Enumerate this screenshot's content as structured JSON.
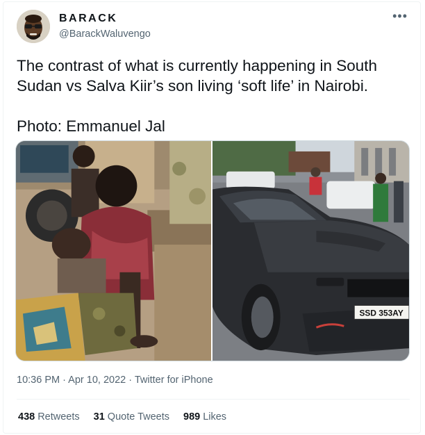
{
  "tweet": {
    "author": {
      "display_name": "BARACK",
      "handle": "@BarackWaluvengo"
    },
    "more_icon": "more-options-icon",
    "text_lines": [
      "The contrast of what is currently happening in South",
      "Sudan vs Salva Kiir’s son living ‘soft life’ in Nairobi.",
      "Photo: Emmanuel Jal"
    ],
    "media": {
      "plate_text": "SSD  353AY"
    },
    "timestamp": {
      "time": "10:36 PM",
      "date": "Apr 10, 2022",
      "source": "Twitter for iPhone"
    },
    "stats": {
      "retweets_count": "438",
      "retweets_label": "Retweets",
      "quotes_count": "31",
      "quotes_label": "Quote Tweets",
      "likes_count": "989",
      "likes_label": "Likes"
    }
  }
}
